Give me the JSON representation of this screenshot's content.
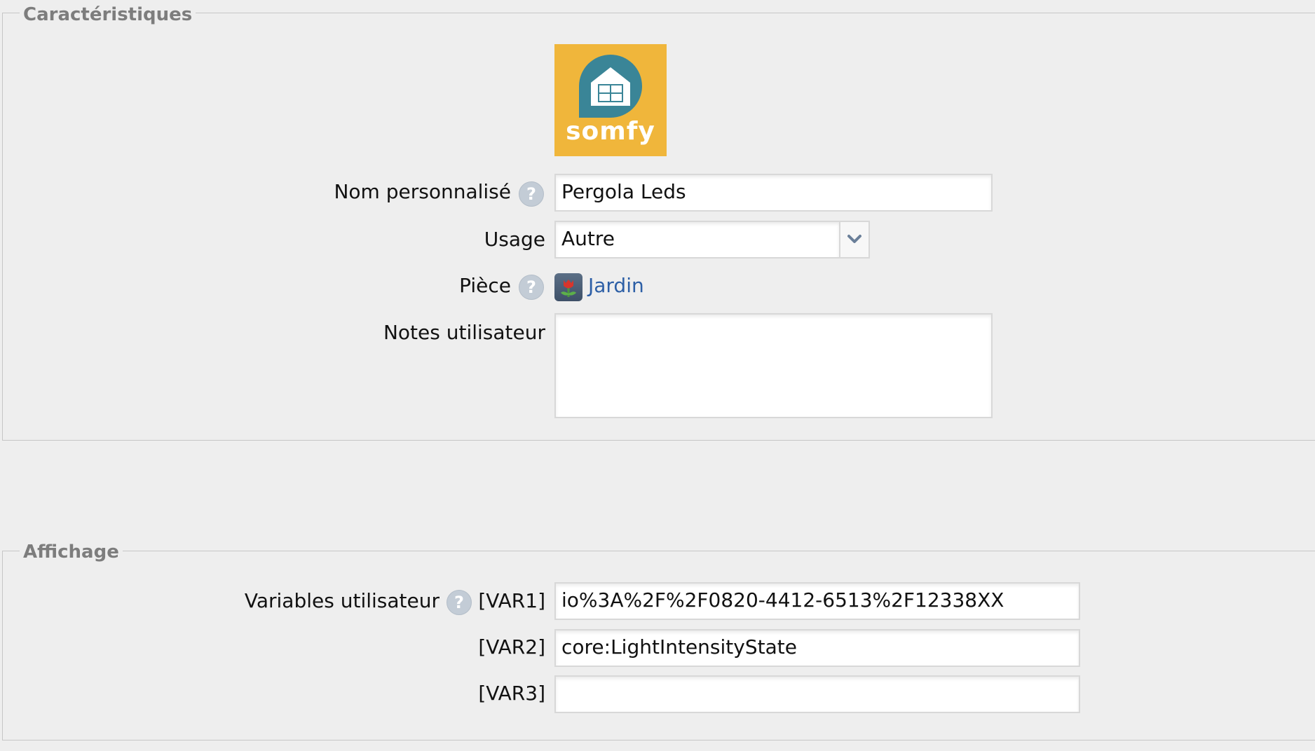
{
  "caracteristiques": {
    "legend": "Caractéristiques",
    "logo_text": "somfy",
    "fields": {
      "nom_label": "Nom personnalisé",
      "nom_value": "Pergola Leds",
      "usage_label": "Usage",
      "usage_value": "Autre",
      "piece_label": "Pièce",
      "piece_value": "Jardin",
      "notes_label": "Notes utilisateur",
      "notes_value": ""
    },
    "help_glyph": "?"
  },
  "affichage": {
    "legend": "Affichage",
    "variables_label": "Variables utilisateur",
    "vars": [
      {
        "label": "[VAR1]",
        "value": "io%3A%2F%2F0820-4412-6513%2F12338XX"
      },
      {
        "label": "[VAR2]",
        "value": "core:LightIntensityState"
      },
      {
        "label": "[VAR3]",
        "value": ""
      }
    ]
  },
  "colors": {
    "logo_bg": "#f0b63b",
    "logo_house": "#3a8597",
    "link": "#2d5fa6",
    "legend": "#7d7d7d"
  },
  "icons": [
    "somfy-logo",
    "help-icon",
    "chevron-down-icon",
    "garden-flower-icon"
  ]
}
